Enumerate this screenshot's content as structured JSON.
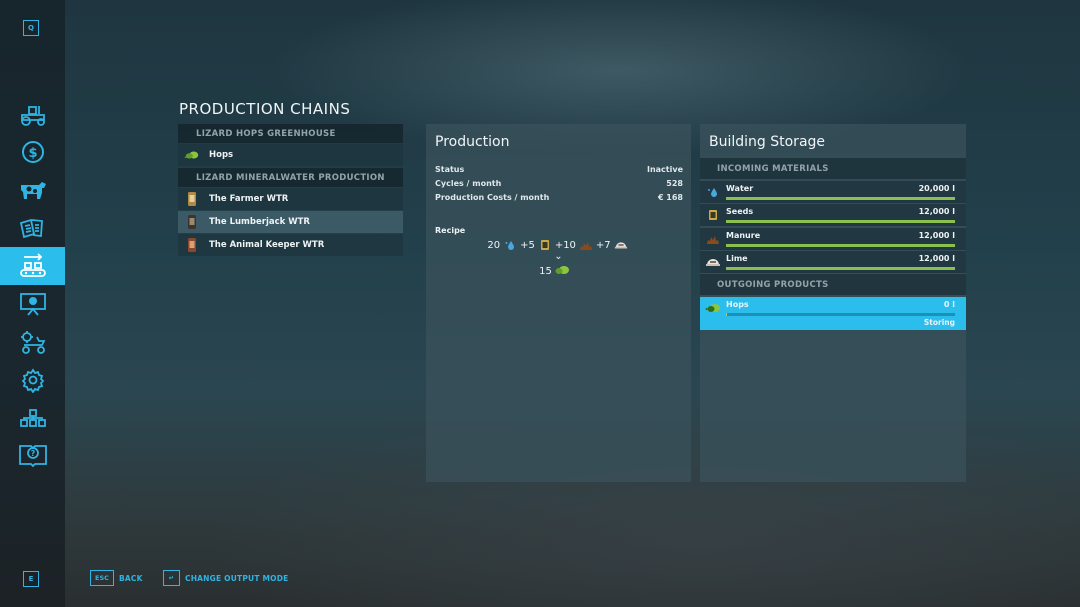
{
  "sidebar": {
    "top_key": "Q",
    "bottom_key": "E",
    "items": [
      {
        "icon": "tractor-icon",
        "active": false
      },
      {
        "icon": "dollar-icon",
        "active": false
      },
      {
        "icon": "cow-icon",
        "active": false
      },
      {
        "icon": "contracts-icon",
        "active": false
      },
      {
        "icon": "production-icon",
        "active": true
      },
      {
        "icon": "stats-presentation-icon",
        "active": false
      },
      {
        "icon": "garage-icon",
        "active": false
      },
      {
        "icon": "settings-gear-icon",
        "active": false
      },
      {
        "icon": "hierarchy-icon",
        "active": false
      },
      {
        "icon": "help-book-icon",
        "active": false
      }
    ]
  },
  "production_chains": {
    "title": "PRODUCTION CHAINS",
    "groups": [
      {
        "name": "LIZARD HOPS GREENHOUSE",
        "items": [
          {
            "label": "Hops",
            "icon": "hops-icon",
            "selected": false
          }
        ]
      },
      {
        "name": "LIZARD MINERALWATER PRODUCTION",
        "items": [
          {
            "label": "The Farmer WTR",
            "icon": "bottle-icon",
            "selected": false
          },
          {
            "label": "The Lumberjack WTR",
            "icon": "bottle-icon",
            "selected": true
          },
          {
            "label": "The Animal Keeper WTR",
            "icon": "bottle-icon",
            "selected": false
          }
        ]
      }
    ]
  },
  "production": {
    "title": "Production",
    "rows": [
      {
        "label": "Status",
        "value": "Inactive"
      },
      {
        "label": "Cycles / month",
        "value": "528"
      },
      {
        "label": "Production Costs / month",
        "value": "€ 168"
      }
    ],
    "recipe_label": "Recipe",
    "recipe_inputs": [
      {
        "prefix": "20",
        "icon": "water-drop-icon"
      },
      {
        "prefix": "+5",
        "icon": "seeds-bag-icon"
      },
      {
        "prefix": "+10",
        "icon": "manure-icon"
      },
      {
        "prefix": "+7",
        "icon": "lime-icon"
      }
    ],
    "recipe_arrow": "⌄",
    "recipe_output": {
      "amount": "15",
      "icon": "hops-icon"
    }
  },
  "storage": {
    "title": "Building Storage",
    "incoming_label": "INCOMING MATERIALS",
    "incoming": [
      {
        "name": "Water",
        "amount": "20,000 l",
        "fill": 1.0,
        "icon": "water-drop-icon"
      },
      {
        "name": "Seeds",
        "amount": "12,000 l",
        "fill": 1.0,
        "icon": "seeds-bag-icon"
      },
      {
        "name": "Manure",
        "amount": "12,000 l",
        "fill": 1.0,
        "icon": "manure-icon"
      },
      {
        "name": "Lime",
        "amount": "12,000 l",
        "fill": 1.0,
        "icon": "lime-icon"
      }
    ],
    "outgoing_label": "OUTGOING PRODUCTS",
    "outgoing": [
      {
        "name": "Hops",
        "amount": "0 l",
        "fill": 0.0,
        "state": "Storing",
        "icon": "hops-icon"
      }
    ]
  },
  "footer": {
    "back_key": "ESC",
    "back_label": "BACK",
    "mode_key": "↵",
    "mode_label": "CHANGE OUTPUT MODE"
  },
  "colors": {
    "accent": "#2bbdec",
    "fill_bar": "#8ac14e"
  }
}
